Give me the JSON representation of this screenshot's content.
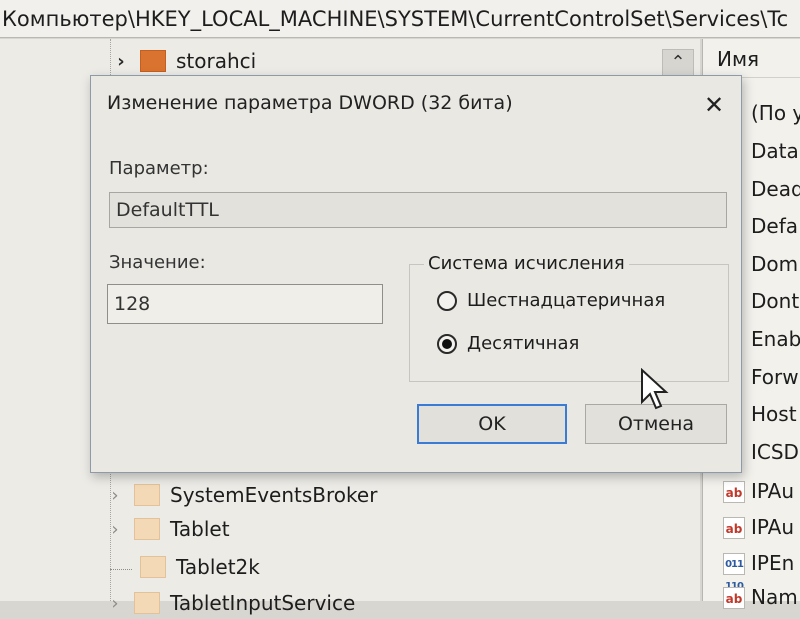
{
  "address": {
    "path": "Компьютер\\HKEY_LOCAL_MACHINE\\SYSTEM\\CurrentControlSet\\Services\\Tc"
  },
  "tree": {
    "items": [
      {
        "label": "storahci"
      },
      {
        "label": "SystemEventsBroker"
      },
      {
        "label": "Tablet"
      },
      {
        "label": "Tablet2k"
      },
      {
        "label": "TabletInputService"
      }
    ]
  },
  "values_pane": {
    "header": "Имя",
    "rows": [
      "(По у",
      "DataB",
      "Dead",
      "Defa",
      "Dom",
      "Dont",
      "Enab",
      "Forw",
      "Host",
      "ICSD",
      "IPAu",
      "IPAu",
      "IPEn",
      "Nam"
    ],
    "icon_ab": "ab",
    "icon_bin": "011 110"
  },
  "dialog": {
    "title": "Изменение параметра DWORD (32 бита)",
    "close_glyph": "✕",
    "param_label": "Параметр:",
    "param_value": "DefaultTTL",
    "value_label": "Значение:",
    "value_value": "128",
    "radix_group": "Система исчисления",
    "radix_hex": "Шестнадцатеричная",
    "radix_dec": "Десятичная",
    "ok": "OK",
    "cancel": "Отмена"
  },
  "colors": {
    "accent": "#3a7bd5",
    "folder": "#f3d9b5",
    "folder_selected": "#d9732f"
  }
}
